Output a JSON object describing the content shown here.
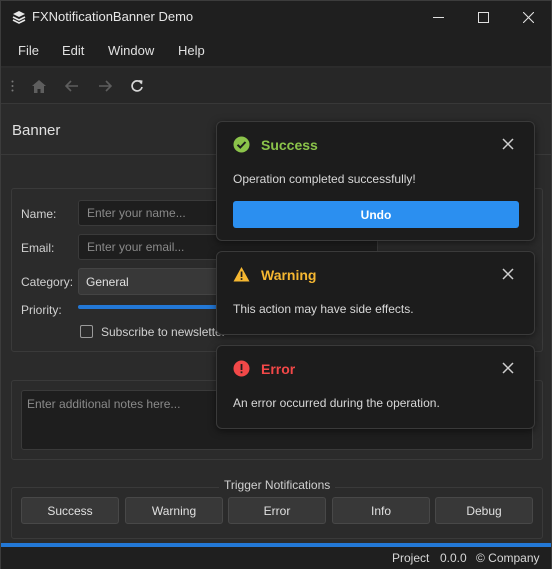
{
  "window": {
    "title": "FXNotificationBanner Demo"
  },
  "menu": [
    "File",
    "Edit",
    "Window",
    "Help"
  ],
  "section": {
    "title": "Banner"
  },
  "form": {
    "name_label": "Name:",
    "name_placeholder": "Enter your name...",
    "email_label": "Email:",
    "email_placeholder": "Enter your email...",
    "category_label": "Category:",
    "category_value": "General",
    "priority_label": "Priority:",
    "subscribe_label": "Subscribe to newsletter"
  },
  "notes": {
    "placeholder": "Enter additional notes here..."
  },
  "trigger": {
    "title": "Trigger Notifications",
    "buttons": [
      "Success",
      "Warning",
      "Error",
      "Info",
      "Debug"
    ]
  },
  "status": {
    "project": "Project",
    "version": "0.0.0",
    "company": "© Company"
  },
  "notifications": [
    {
      "title": "Success",
      "message": "Operation completed successfully!",
      "action": "Undo",
      "color": "#8bc34a"
    },
    {
      "title": "Warning",
      "message": "This action may have side effects.",
      "color": "#f5b731"
    },
    {
      "title": "Error",
      "message": "An error occurred during the operation.",
      "color": "#f24848"
    }
  ],
  "colors": {
    "accent": "#2378d6",
    "undo_button": "#2b8ff0"
  }
}
